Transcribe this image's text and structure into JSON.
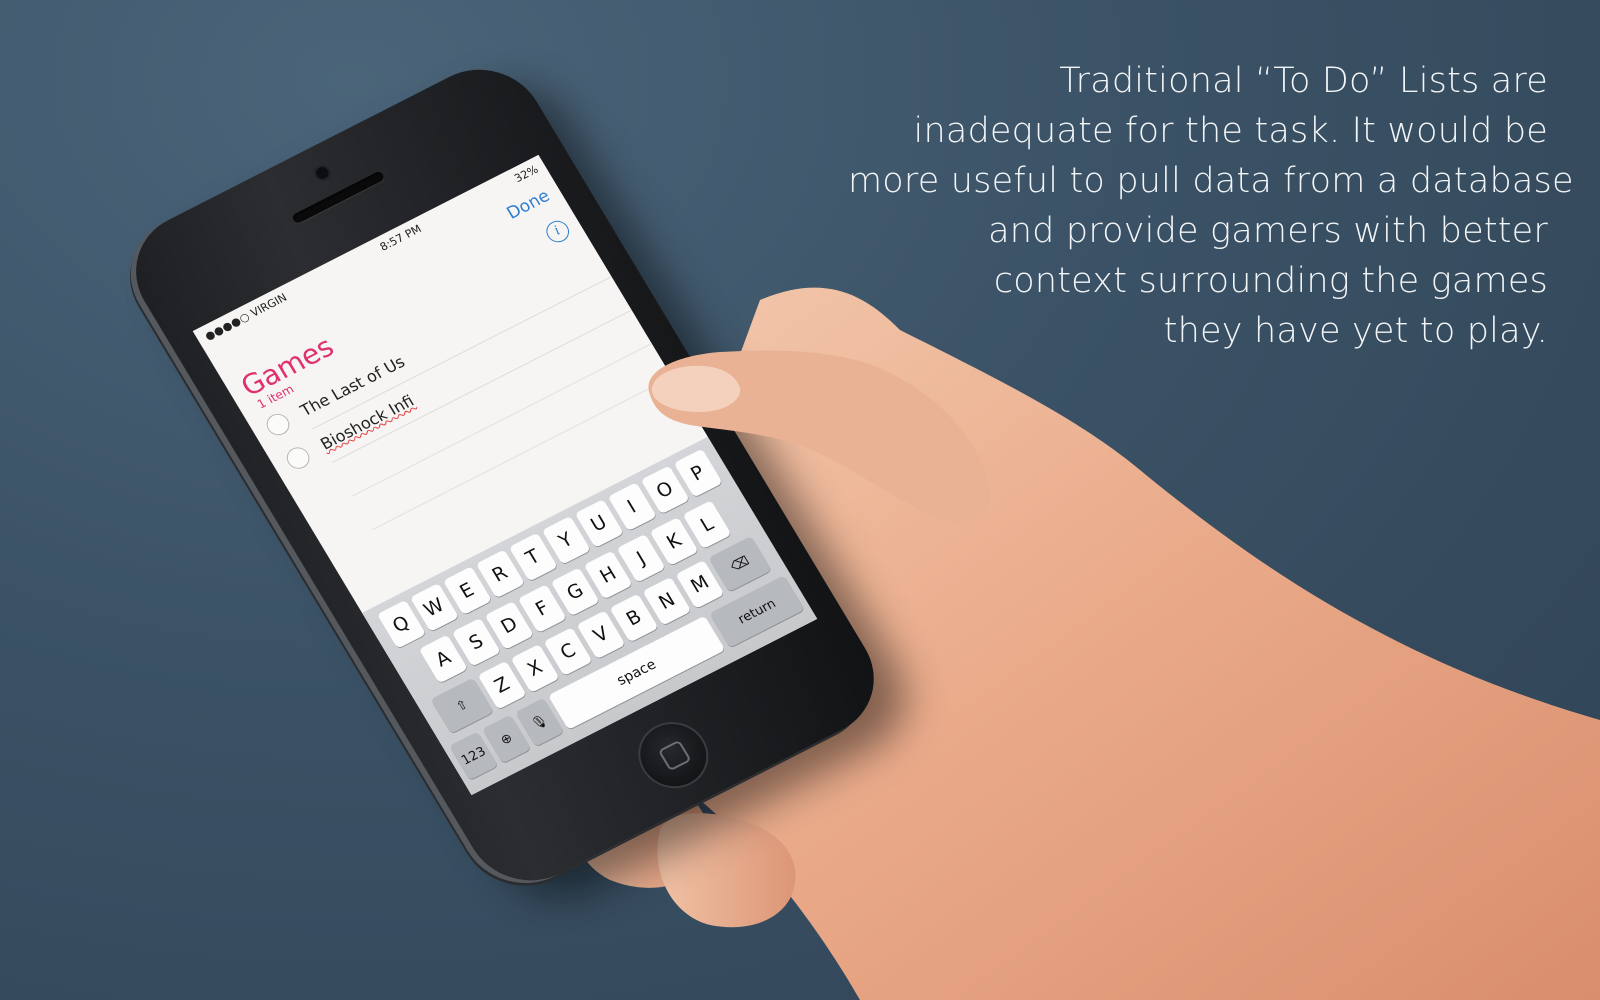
{
  "caption": {
    "lines": [
      "Traditional “To Do” Lists are",
      "inadequate for the task. It would be",
      "more useful to pull data from a database",
      "and provide gamers with better",
      "context surrounding the games",
      "they have yet to play."
    ]
  },
  "phone": {
    "status": {
      "carrier": "●●●●○ VIRGIN",
      "time": "8:57 PM",
      "battery": "32%"
    },
    "nav": {
      "done_label": "Done"
    },
    "list": {
      "title": "Games",
      "count": "1 item",
      "items": [
        {
          "text": "The Last of Us"
        },
        {
          "text": "Bioshock Infi"
        }
      ]
    },
    "keyboard": {
      "row1": [
        "Q",
        "W",
        "E",
        "R",
        "T",
        "Y",
        "U",
        "I",
        "O",
        "P"
      ],
      "row2": [
        "A",
        "S",
        "D",
        "F",
        "G",
        "H",
        "J",
        "K",
        "L"
      ],
      "row3": [
        "Z",
        "X",
        "C",
        "V",
        "B",
        "N",
        "M"
      ],
      "numbers_label": "123",
      "space_label": "space",
      "return_label": "return"
    }
  },
  "colors": {
    "background": "#3b5266",
    "list_accent": "#e0306e",
    "link_blue": "#2f7fd0",
    "caption_text": "#f2f5f7"
  }
}
